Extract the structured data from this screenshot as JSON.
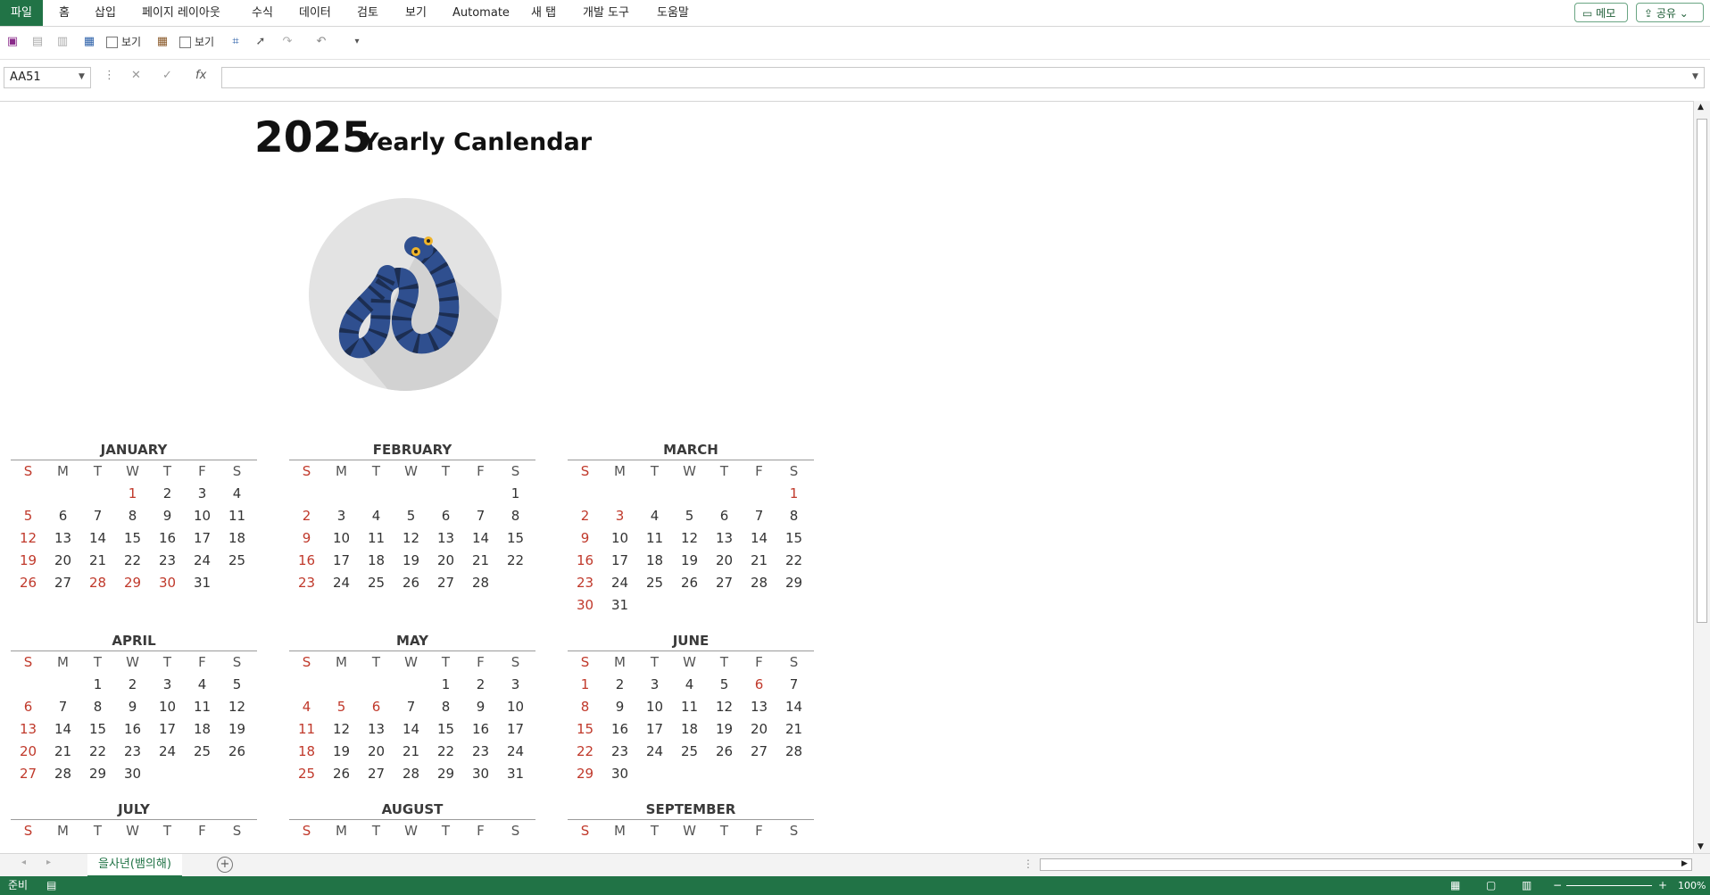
{
  "ribbon": {
    "tabs": [
      "파일",
      "홈",
      "삽입",
      "페이지 레이아웃",
      "수식",
      "데이터",
      "검토",
      "보기",
      "Automate",
      "새 탭",
      "개발 도구",
      "도움말"
    ],
    "memo_button": "메모",
    "share_button": "공유"
  },
  "quick_access": {
    "view_checkbox_1": "보기",
    "view_checkbox_2": "보기"
  },
  "formula_bar": {
    "name_box": "AA51",
    "fx_label": "fx",
    "formula": ""
  },
  "sheet": {
    "title_year": "2025",
    "title_text": "Yearly Canlendar",
    "weekdays": [
      "S",
      "M",
      "T",
      "W",
      "T",
      "F",
      "S"
    ],
    "months": [
      {
        "name": "JANUARY",
        "days": [
          "",
          "",
          "",
          1,
          2,
          3,
          4,
          5,
          6,
          7,
          8,
          9,
          10,
          11,
          12,
          13,
          14,
          15,
          16,
          17,
          18,
          19,
          20,
          21,
          22,
          23,
          24,
          25,
          26,
          27,
          28,
          29,
          30,
          31
        ],
        "red": [
          1,
          28,
          29,
          30
        ]
      },
      {
        "name": "FEBRUARY",
        "days": [
          "",
          "",
          "",
          "",
          "",
          "",
          1,
          2,
          3,
          4,
          5,
          6,
          7,
          8,
          9,
          10,
          11,
          12,
          13,
          14,
          15,
          16,
          17,
          18,
          19,
          20,
          21,
          22,
          23,
          24,
          25,
          26,
          27,
          28
        ],
        "red": []
      },
      {
        "name": "MARCH",
        "days": [
          "",
          "",
          "",
          "",
          "",
          "",
          1,
          2,
          3,
          4,
          5,
          6,
          7,
          8,
          9,
          10,
          11,
          12,
          13,
          14,
          15,
          16,
          17,
          18,
          19,
          20,
          21,
          22,
          23,
          24,
          25,
          26,
          27,
          28,
          29,
          30,
          31
        ],
        "red": [
          1,
          3
        ]
      },
      {
        "name": "APRIL",
        "days": [
          "",
          "",
          1,
          2,
          3,
          4,
          5,
          6,
          7,
          8,
          9,
          10,
          11,
          12,
          13,
          14,
          15,
          16,
          17,
          18,
          19,
          20,
          21,
          22,
          23,
          24,
          25,
          26,
          27,
          28,
          29,
          30
        ],
        "red": []
      },
      {
        "name": "MAY",
        "days": [
          "",
          "",
          "",
          "",
          1,
          2,
          3,
          4,
          5,
          6,
          7,
          8,
          9,
          10,
          11,
          12,
          13,
          14,
          15,
          16,
          17,
          18,
          19,
          20,
          21,
          22,
          23,
          24,
          25,
          26,
          27,
          28,
          29,
          30,
          31
        ],
        "red": [
          5,
          6
        ]
      },
      {
        "name": "JUNE",
        "days": [
          1,
          2,
          3,
          4,
          5,
          6,
          7,
          8,
          9,
          10,
          11,
          12,
          13,
          14,
          15,
          16,
          17,
          18,
          19,
          20,
          21,
          22,
          23,
          24,
          25,
          26,
          27,
          28,
          29,
          30
        ],
        "red": [
          6
        ]
      },
      {
        "name": "JULY",
        "days": [],
        "red": []
      },
      {
        "name": "AUGUST",
        "days": [],
        "red": []
      },
      {
        "name": "SEPTEMBER",
        "days": [],
        "red": []
      }
    ]
  },
  "sheet_tabs": {
    "active": "을사년(뱀의해)"
  },
  "status_bar": {
    "ready": "준비",
    "zoom": "100%"
  }
}
